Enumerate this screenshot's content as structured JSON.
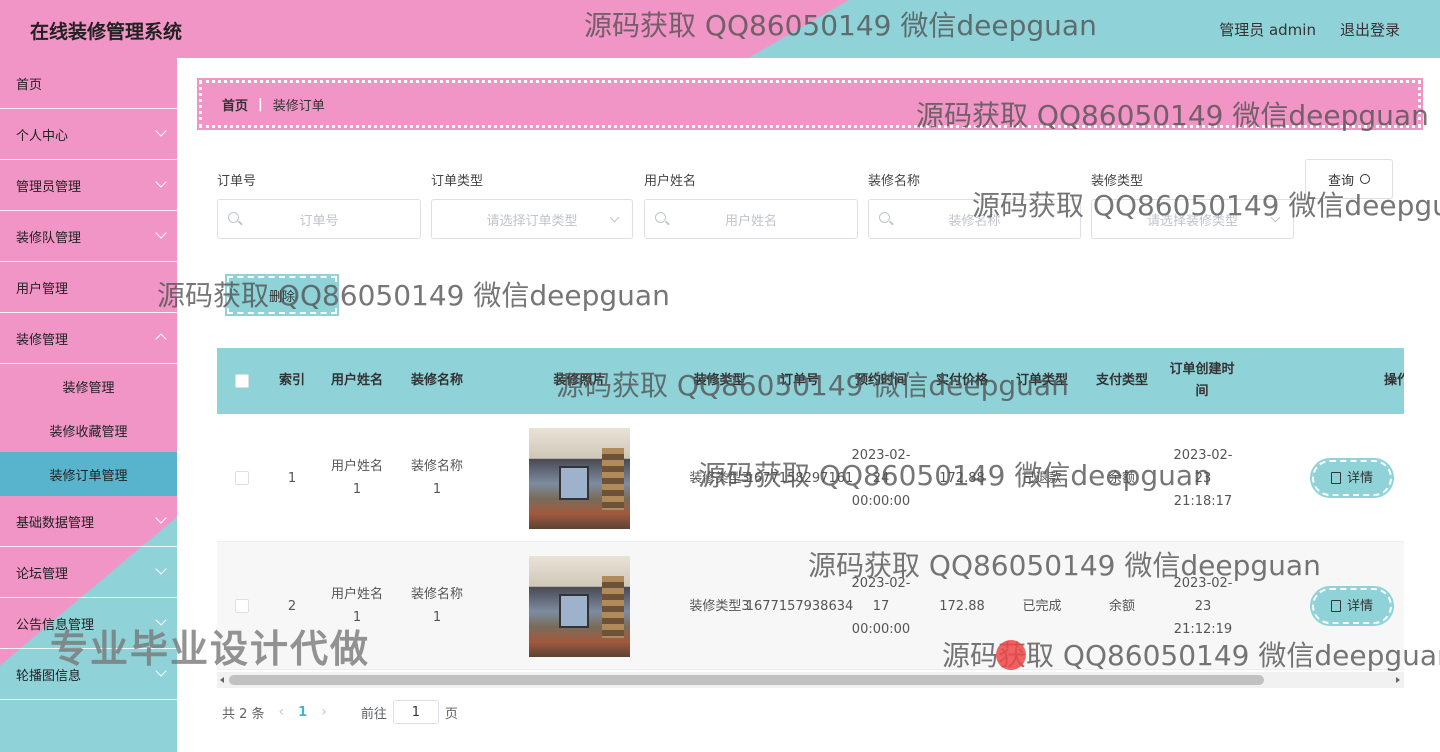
{
  "header": {
    "app_title": "在线装修管理系统",
    "admin_label": "管理员 admin",
    "logout_label": "退出登录"
  },
  "sidebar": {
    "items": [
      {
        "label": "首页"
      },
      {
        "label": "个人中心"
      },
      {
        "label": "管理员管理"
      },
      {
        "label": "装修队管理"
      },
      {
        "label": "用户管理"
      },
      {
        "label": "装修管理"
      }
    ],
    "sub_items": [
      {
        "label": "装修管理"
      },
      {
        "label": "装修收藏管理"
      },
      {
        "label": "装修订单管理"
      }
    ],
    "items_after": [
      {
        "label": "基础数据管理"
      },
      {
        "label": "论坛管理"
      },
      {
        "label": "公告信息管理"
      },
      {
        "label": "轮播图信息"
      }
    ]
  },
  "breadcrumb": {
    "home": "首页",
    "current": "装修订单"
  },
  "filters": {
    "order_no": {
      "label": "订单号",
      "placeholder": "订单号"
    },
    "order_type": {
      "label": "订单类型",
      "placeholder": "请选择订单类型"
    },
    "user_name": {
      "label": "用户姓名",
      "placeholder": "用户姓名"
    },
    "deco_name": {
      "label": "装修名称",
      "placeholder": "装修名称"
    },
    "deco_type": {
      "label": "装修类型",
      "placeholder": "请选择装修类型"
    },
    "query_label": "查询"
  },
  "actions": {
    "delete_label": "删除"
  },
  "table": {
    "headers": {
      "index": "索引",
      "user_name": "用户姓名",
      "deco_name": "装修名称",
      "deco_photo": "装修照片",
      "deco_type": "装修类型",
      "order_no": "订单号",
      "appointment": "预约时间",
      "paid": "实付价格",
      "order_type": "订单类型",
      "pay_type": "支付类型",
      "created": "订单创建时间",
      "ops": "操作"
    },
    "rows": [
      {
        "index": "1",
        "user_name": "用户姓名1",
        "deco_name": "装修名称1",
        "deco_type": "装修类型3",
        "order_no": "1677158297161",
        "appointment": "2023-02-24 00:00:00",
        "paid": "172.88",
        "order_type": "已退款",
        "pay_type": "余额",
        "created": "2023-02-23 21:18:17",
        "detail_label": "详情"
      },
      {
        "index": "2",
        "user_name": "用户姓名1",
        "deco_name": "装修名称1",
        "deco_type": "装修类型3",
        "order_no": "1677157938634",
        "appointment": "2023-02-17 00:00:00",
        "paid": "172.88",
        "order_type": "已完成",
        "pay_type": "余额",
        "created": "2023-02-23 21:12:19",
        "detail_label": "详情"
      }
    ]
  },
  "pagination": {
    "total": "共 2 条",
    "current_page": "1",
    "goto_label": "前往",
    "goto_value": "1",
    "page_suffix": "页"
  },
  "overlays": {
    "watermark": "源码获取 QQ86050149 微信deepguan",
    "promo": "专业毕业设计代做"
  }
}
